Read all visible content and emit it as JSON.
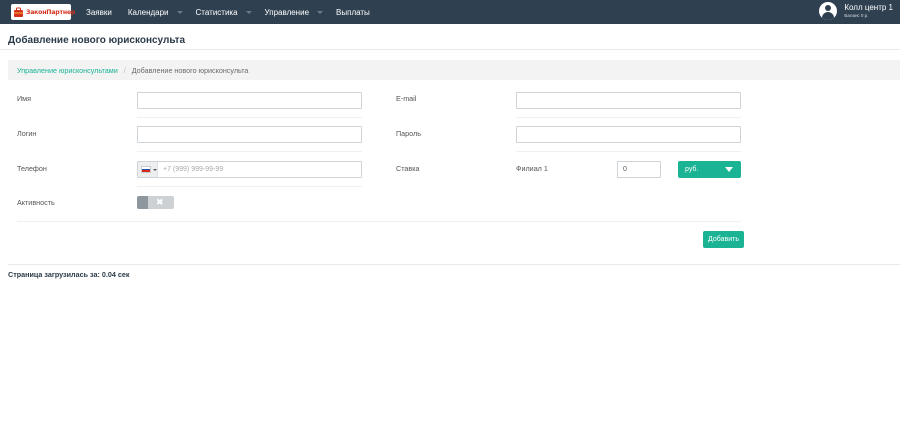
{
  "header": {
    "logo_text": "ЗаконПартнер",
    "nav": [
      {
        "label": "Заявки",
        "dropdown": false
      },
      {
        "label": "Календари",
        "dropdown": true
      },
      {
        "label": "Статистика",
        "dropdown": true
      },
      {
        "label": "Управление",
        "dropdown": true
      },
      {
        "label": "Выплаты",
        "dropdown": false
      }
    ],
    "user": {
      "name": "Колл центр 1",
      "balance": "Баланс 0 р."
    }
  },
  "page": {
    "title": "Добавление нового юрисконсульта"
  },
  "breadcrumb": {
    "link": "Управление юрисконсультами",
    "separator": "/",
    "current": "Добавление нового юрисконсульта"
  },
  "form": {
    "name_label": "Имя",
    "name_value": "",
    "email_label": "E-mail",
    "email_value": "",
    "login_label": "Логин",
    "login_value": "",
    "password_label": "Пароль",
    "password_value": "",
    "phone_label": "Телефон",
    "phone_placeholder": "+7 (999) 999-99-99",
    "rate_label": "Ставка",
    "branch_label": "Филиал 1",
    "rate_value": "0",
    "currency_selected": "руб.",
    "activity_label": "Активность",
    "activity_on": false,
    "toggle_off_symbol": "✖",
    "submit_label": "Добавить"
  },
  "footer": {
    "load_time": "Страница загрузилась за: 0.04 сек"
  },
  "colors": {
    "nav_bg": "#2f4050",
    "accent": "#1ab394"
  }
}
